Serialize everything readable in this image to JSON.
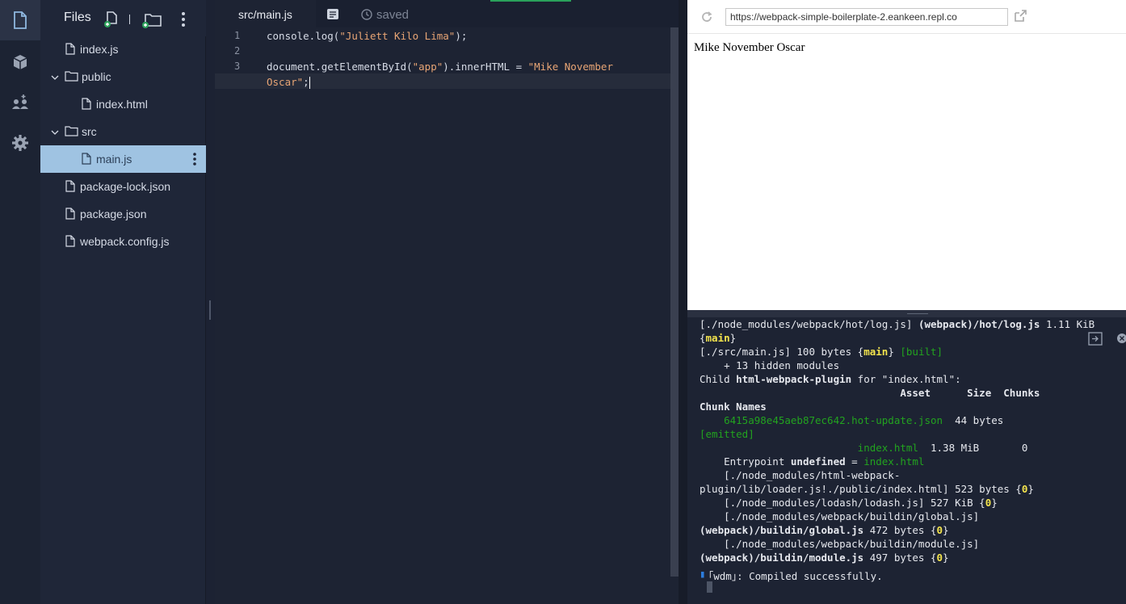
{
  "rail": {
    "items": [
      {
        "icon": "files-icon"
      },
      {
        "icon": "packages-icon"
      },
      {
        "icon": "multiplayer-icon"
      },
      {
        "icon": "settings-icon"
      }
    ]
  },
  "files": {
    "title": "Files",
    "tree": [
      {
        "name": "index.js",
        "type": "file"
      },
      {
        "name": "public",
        "type": "folder"
      },
      {
        "name": "index.html",
        "type": "file"
      },
      {
        "name": "src",
        "type": "folder"
      },
      {
        "name": "main.js",
        "type": "file",
        "selected": true
      },
      {
        "name": "package-lock.json",
        "type": "file"
      },
      {
        "name": "package.json",
        "type": "file"
      },
      {
        "name": "webpack.config.js",
        "type": "file"
      }
    ]
  },
  "editor": {
    "tab_label": "src/main.js",
    "status": "saved",
    "lines": [
      {
        "num": "1",
        "parts": [
          {
            "t": "console.log("
          },
          {
            "t": "\"Juliett Kilo Lima\"",
            "cls": "str"
          },
          {
            "t": ");"
          }
        ]
      },
      {
        "num": "2",
        "parts": []
      },
      {
        "num": "3",
        "parts": [
          {
            "t": "document.getElementById("
          },
          {
            "t": "\"app\"",
            "cls": "str"
          },
          {
            "t": ").innerHTML = "
          },
          {
            "t": "\"Mike November",
            "cls": "str"
          }
        ]
      },
      {
        "num": "",
        "parts": [
          {
            "t": "Oscar\"",
            "cls": "str"
          },
          {
            "t": ";"
          }
        ]
      }
    ]
  },
  "preview": {
    "url": "https://webpack-simple-boilerplate-2.eankeen.repl.co",
    "body_text": "Mike November Oscar"
  },
  "terminal": {
    "lines": [
      [
        {
          "t": "[./node_modules/webpack/hot/log.js] "
        },
        {
          "t": "(webpack)/hot/log.js",
          "cls": "b"
        },
        {
          "t": " 1.11 KiB"
        }
      ],
      [
        {
          "t": "{"
        },
        {
          "t": "main",
          "cls": "y"
        },
        {
          "t": "}"
        }
      ],
      [
        {
          "t": "[./src/main.js] 100 bytes {"
        },
        {
          "t": "main",
          "cls": "y"
        },
        {
          "t": "} "
        },
        {
          "t": "[built]",
          "cls": "g"
        }
      ],
      [
        {
          "t": "    + 13 hidden modules"
        }
      ],
      [
        {
          "t": "Child "
        },
        {
          "t": "html-webpack-plugin",
          "cls": "b"
        },
        {
          "t": " for \"index.html\":"
        }
      ],
      [
        {
          "t": "                                 Asset      Size  Chunks",
          "cls": "b"
        }
      ],
      [
        {
          "t": "Chunk Names",
          "cls": "b"
        }
      ],
      [
        {
          "t": "    "
        },
        {
          "t": "6415a98e45aeb87ec642.hot-update.json",
          "cls": "g"
        },
        {
          "t": "  44 bytes"
        }
      ],
      [
        {
          "t": "[emitted]",
          "cls": "g"
        }
      ],
      [
        {
          "t": "                          "
        },
        {
          "t": "index.html",
          "cls": "g"
        },
        {
          "t": "  1.38 MiB       0"
        }
      ],
      [
        {
          "t": "    Entrypoint "
        },
        {
          "t": "undefined",
          "cls": "b"
        },
        {
          "t": " = "
        },
        {
          "t": "index.html",
          "cls": "g"
        }
      ],
      [
        {
          "t": "    [./node_modules/html-webpack-"
        }
      ],
      [
        {
          "t": "plugin/lib/loader.js!./public/index.html] 523 bytes {"
        },
        {
          "t": "0",
          "cls": "y"
        },
        {
          "t": "}"
        }
      ],
      [
        {
          "t": "    [./node_modules/lodash/lodash.js] 527 KiB {"
        },
        {
          "t": "0",
          "cls": "y"
        },
        {
          "t": "}"
        }
      ],
      [
        {
          "t": "    [./node_modules/webpack/buildin/global.js]"
        }
      ],
      [
        {
          "t": "(webpack)/buildin/global.js",
          "cls": "b"
        },
        {
          "t": " 472 bytes {"
        },
        {
          "t": "0",
          "cls": "y"
        },
        {
          "t": "}"
        }
      ],
      [
        {
          "t": "    [./node_modules/webpack/buildin/module.js]"
        }
      ],
      [
        {
          "t": "(webpack)/buildin/module.js",
          "cls": "b"
        },
        {
          "t": " 497 bytes {"
        },
        {
          "t": "0",
          "cls": "y"
        },
        {
          "t": "}"
        }
      ],
      [
        {
          "t": "｢wdm｣: Compiled successfully."
        }
      ]
    ]
  }
}
